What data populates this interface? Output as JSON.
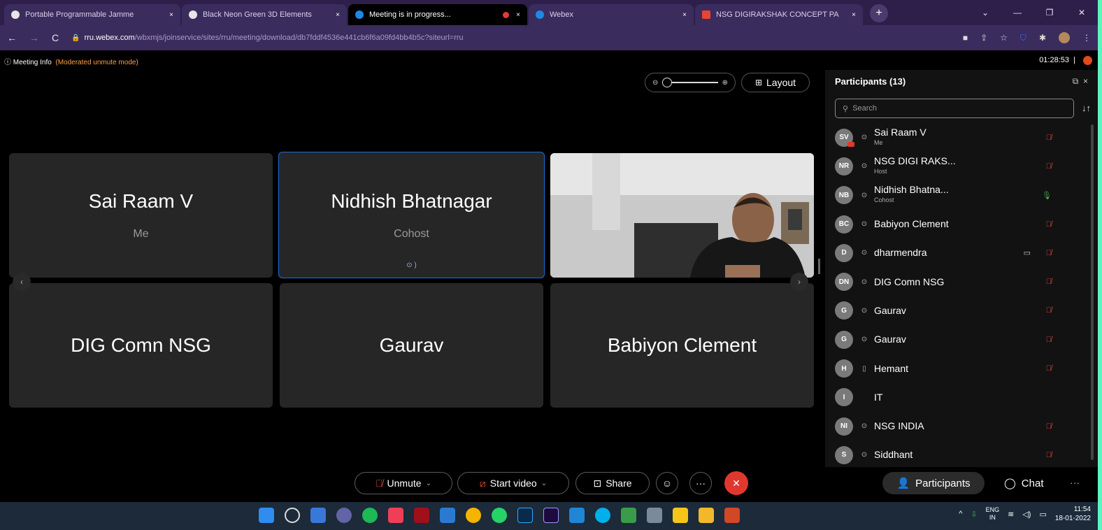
{
  "browser": {
    "tabs": [
      {
        "title": "Portable Programmable Jamme",
        "color": "#3b82f6"
      },
      {
        "title": "Black Neon Green 3D Elements",
        "color": "#6b7280"
      },
      {
        "title": "Meeting is in progress...",
        "color": "#1e88e5",
        "active": true
      },
      {
        "title": "Webex",
        "color": "#1e88e5"
      },
      {
        "title": "NSG DIGIRAKSHAK CONCEPT PA",
        "color": "#ea4335"
      }
    ],
    "close_glyph": "×",
    "new_tab": "+",
    "window_controls": [
      "⌄",
      "—",
      "❐",
      "✕"
    ],
    "nav": [
      "←",
      "→",
      "C"
    ],
    "url_host": "rru.webex.com",
    "url_path": "/wbxmjs/joinservice/sites/rru/meeting/download/db7fddf4536e441cb6f6a09fd4bb4b5c?siteurl=rru",
    "address_icons": [
      "camera-icon",
      "share-icon",
      "star-icon",
      "shield-extension-icon",
      "puzzle-icon",
      "profile-icon",
      "menu-icon"
    ]
  },
  "meeting": {
    "info_label": "ⓘ Meeting Info",
    "mode": "(Moderated unmute mode)",
    "timer": "01:28:53",
    "layout_label": "Layout"
  },
  "tiles": [
    {
      "name": "Sai Raam V",
      "role": "Me"
    },
    {
      "name": "Nidhish Bhatnagar",
      "role": "Cohost",
      "active": true
    },
    {
      "name": "",
      "role": "",
      "video": true
    },
    {
      "name": "DIG Comn NSG",
      "role": ""
    },
    {
      "name": "Gaurav",
      "role": ""
    },
    {
      "name": "Babiyon Clement",
      "role": ""
    }
  ],
  "controls": {
    "unmute": "Unmute",
    "start_video": "Start video",
    "share": "Share",
    "reactions": "☺",
    "more": "···",
    "leave": "✕"
  },
  "participants": {
    "title": "Participants (13)",
    "search_placeholder": "Search",
    "items": [
      {
        "initials": "SV",
        "name": "Sai Raam V",
        "role": "Me",
        "status": "muted"
      },
      {
        "initials": "NR",
        "name": "NSG DIGI RAKS...",
        "role": "Host",
        "status": "muted"
      },
      {
        "initials": "NB",
        "name": "Nidhish Bhatna...",
        "role": "Cohost",
        "status": "unmuted"
      },
      {
        "initials": "BC",
        "name": "Babiyon Clement",
        "role": "",
        "status": "muted"
      },
      {
        "initials": "D",
        "name": "dharmendra",
        "role": "",
        "status": "muted",
        "video": true
      },
      {
        "initials": "DN",
        "name": "DIG Comn NSG",
        "role": "",
        "status": "muted"
      },
      {
        "initials": "G",
        "name": "Gaurav",
        "role": "",
        "status": "muted"
      },
      {
        "initials": "G",
        "name": "Gaurav",
        "role": "",
        "status": "muted"
      },
      {
        "initials": "H",
        "name": "Hemant",
        "role": "",
        "status": "muted",
        "device": "phone"
      },
      {
        "initials": "I",
        "name": "IT",
        "role": "",
        "status": "none"
      },
      {
        "initials": "NI",
        "name": "NSG INDIA",
        "role": "",
        "status": "muted"
      },
      {
        "initials": "S",
        "name": "Siddhant",
        "role": "",
        "status": "muted"
      }
    ],
    "participants_button": "Participants",
    "chat_button": "Chat"
  },
  "taskbar": {
    "icons": [
      "windows-start-icon",
      "search-icon",
      "task-view-icon",
      "teams-icon",
      "spotify-icon",
      "pocket-icon",
      "netflix-icon",
      "vscode-icon",
      "chrome-icon",
      "whatsapp-icon",
      "photoshop-icon",
      "premiere-icon",
      "mail-icon",
      "webex-icon",
      "app-icon",
      "app2-icon",
      "sticky-icon",
      "explorer-icon",
      "powerpoint-icon"
    ],
    "lang_1": "ENG",
    "lang_2": "IN",
    "time": "11:54",
    "date": "18-01-2022"
  },
  "colors": {
    "accent": "#1b6fd6",
    "leave": "#e0382f",
    "muted": "#e04a3a",
    "unmuted": "#4caf50",
    "mode_text": "#ff9d42"
  }
}
